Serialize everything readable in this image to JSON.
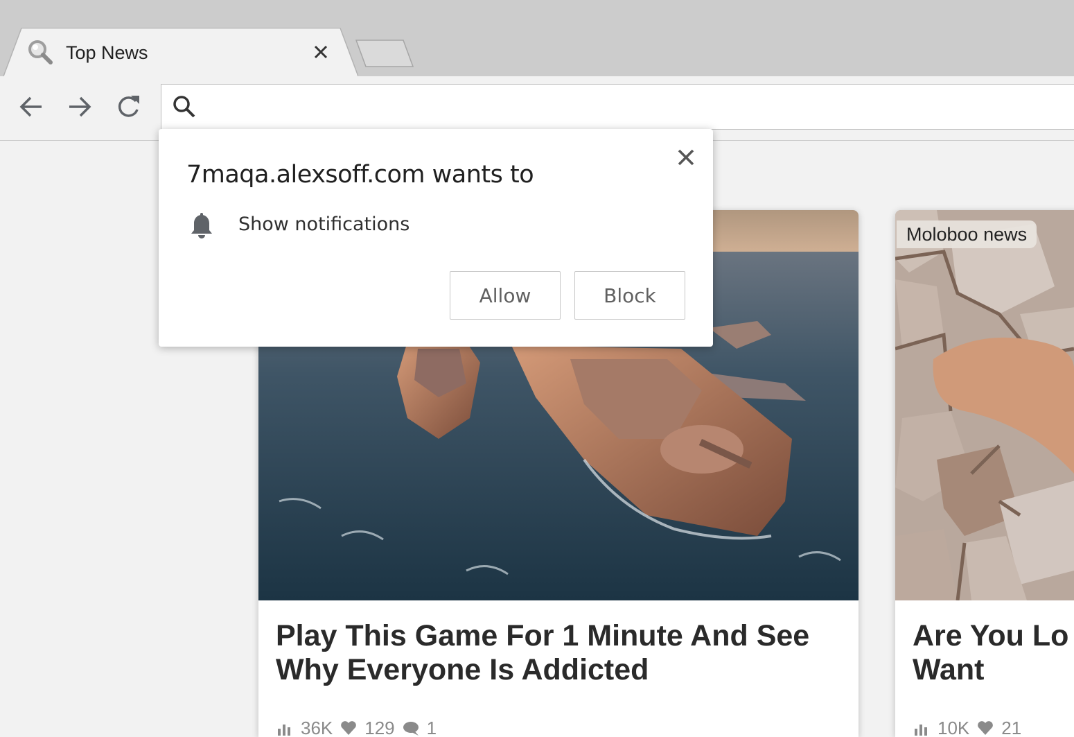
{
  "tab": {
    "title": "Top News"
  },
  "omnibox": {
    "value": "",
    "placeholder": ""
  },
  "permission_popup": {
    "title": "7maqa.alexsoff.com wants to",
    "permission": "Show notifications",
    "allow_label": "Allow",
    "block_label": "Block"
  },
  "cards": [
    {
      "source": "",
      "title": "Play This Game For 1 Minute And See Why Everyone Is Addicted",
      "views": "36K",
      "likes": "129",
      "comments": "1"
    },
    {
      "source": "Moloboo news",
      "title": "Are You Lo\nWant",
      "views": "10K",
      "likes": "21"
    }
  ],
  "colors": {
    "tabstrip": "#cccccc",
    "toolbar": "#f2f2f2",
    "icon_gray": "#5f6368",
    "title_text": "#2a2a2a"
  }
}
